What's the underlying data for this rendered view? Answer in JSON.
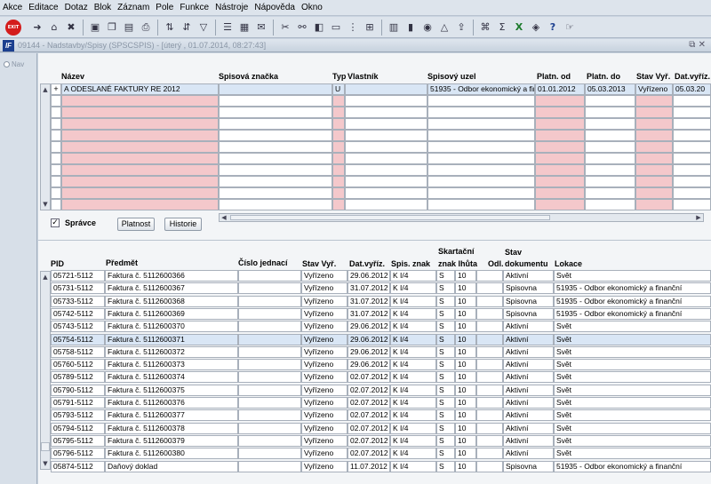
{
  "menu": [
    {
      "label": "Akce"
    },
    {
      "label": "Editace"
    },
    {
      "label": "Dotaz"
    },
    {
      "label": "Blok"
    },
    {
      "label": "Záznam"
    },
    {
      "label": "Pole"
    },
    {
      "label": "Funkce"
    },
    {
      "label": "Nástroje"
    },
    {
      "label": "Nápověda"
    },
    {
      "label": "Okno"
    }
  ],
  "toolbar": {
    "exit_label": "EXIT",
    "icons": [
      "save-icon",
      "home-icon",
      "delete-icon",
      "folder-icon",
      "copy-icon",
      "paste-icon",
      "print-icon",
      "sort-asc-icon",
      "sort-desc-icon",
      "filter-icon",
      "list-icon",
      "report-icon",
      "mail-icon",
      "cut-icon",
      "link-icon",
      "record-icon",
      "document-icon",
      "tree-icon",
      "grid-icon",
      "calculator-icon",
      "chart-icon",
      "globe-icon",
      "triangle-icon",
      "export-icon",
      "attach-icon",
      "sum-icon",
      "excel-icon",
      "lock-icon",
      "help-icon",
      "whatsnew-icon"
    ]
  },
  "window": {
    "logo": "IF",
    "title": "09144 - Nadstavby/Spisy (SPSCSPIS) - [úterý , 01.07.2014, 08:27:43]",
    "controls": "⧉ ✕"
  },
  "nav": {
    "label": "Nav"
  },
  "top_table": {
    "headers": [
      "Název",
      "Spisová značka",
      "Typ",
      "Vlastník",
      "Spisový uzel",
      "Platn. od",
      "Platn. do",
      "Stav Vyř.",
      "Dat.vyříz."
    ],
    "first_row": {
      "indicator": "+",
      "nazev": "A ODESLANÉ FAKTURY RE 2012",
      "spisova_znacka": "",
      "typ": "U",
      "vlastnik": "",
      "spisovy_uzel": "51935 - Odbor ekonomický a fin",
      "platn_od": "01.01.2012",
      "platn_do": "05.03.2013",
      "stav_vyr": "Vyřízeno",
      "dat_vyriz": "05.03.20"
    },
    "empty_rows": 10
  },
  "controls": {
    "spravce_label": "Správce",
    "spravce_checked": "✓",
    "platnost_label": "Platnost",
    "historie_label": "Historie"
  },
  "bottom_table": {
    "headers": {
      "pid": "PID",
      "predmet": "Předmět",
      "cislo_jednaci": "Číslo jednací",
      "stav_vyr": "Stav Vyř.",
      "dat_vyriz": "Dat.vyříz.",
      "spis_znak": "Spis. znak",
      "skartacni_1": "Skartační",
      "skartacni_2": "znak lhůta",
      "odl": "Odl.",
      "stav_dok_1": "Stav",
      "stav_dok_2": "dokumentu",
      "lokace": "Lokace"
    },
    "rows": [
      {
        "pid": "05721-5112",
        "predmet": "Faktura č. 5112600366",
        "cj": "",
        "stav": "Vyřízeno",
        "dat": "29.06.2012",
        "spis": "K I/4",
        "znak": "S",
        "lhuta": "10",
        "odl": "",
        "stavdok": "Aktivní",
        "lokace": "Svět"
      },
      {
        "pid": "05731-5112",
        "predmet": "Faktura č. 5112600367",
        "cj": "",
        "stav": "Vyřízeno",
        "dat": "31.07.2012",
        "spis": "K I/4",
        "znak": "S",
        "lhuta": "10",
        "odl": "",
        "stavdok": "Spisovna",
        "lokace": "51935 - Odbor ekonomický a finanční"
      },
      {
        "pid": "05733-5112",
        "predmet": "Faktura č. 5112600368",
        "cj": "",
        "stav": "Vyřízeno",
        "dat": "31.07.2012",
        "spis": "K I/4",
        "znak": "S",
        "lhuta": "10",
        "odl": "",
        "stavdok": "Spisovna",
        "lokace": "51935 - Odbor ekonomický a finanční"
      },
      {
        "pid": "05742-5112",
        "predmet": "Faktura č. 5112600369",
        "cj": "",
        "stav": "Vyřízeno",
        "dat": "31.07.2012",
        "spis": "K I/4",
        "znak": "S",
        "lhuta": "10",
        "odl": "",
        "stavdok": "Spisovna",
        "lokace": "51935 - Odbor ekonomický a finanční"
      },
      {
        "pid": "05743-5112",
        "predmet": "Faktura č. 5112600370",
        "cj": "",
        "stav": "Vyřízeno",
        "dat": "29.06.2012",
        "spis": "K I/4",
        "znak": "S",
        "lhuta": "10",
        "odl": "",
        "stavdok": "Aktivní",
        "lokace": "Svět"
      },
      {
        "pid": "05754-5112",
        "predmet": "Faktura č. 5112600371",
        "cj": "",
        "stav": "Vyřízeno",
        "dat": "29.06.2012",
        "spis": "K I/4",
        "znak": "S",
        "lhuta": "10",
        "odl": "",
        "stavdok": "Aktivní",
        "lokace": "Svět"
      },
      {
        "pid": "05758-5112",
        "predmet": "Faktura č. 5112600372",
        "cj": "",
        "stav": "Vyřízeno",
        "dat": "29.06.2012",
        "spis": "K I/4",
        "znak": "S",
        "lhuta": "10",
        "odl": "",
        "stavdok": "Aktivní",
        "lokace": "Svět"
      },
      {
        "pid": "05760-5112",
        "predmet": "Faktura č. 5112600373",
        "cj": "",
        "stav": "Vyřízeno",
        "dat": "29.06.2012",
        "spis": "K I/4",
        "znak": "S",
        "lhuta": "10",
        "odl": "",
        "stavdok": "Aktivní",
        "lokace": "Svět"
      },
      {
        "pid": "05789-5112",
        "predmet": "Faktura č. 5112600374",
        "cj": "",
        "stav": "Vyřízeno",
        "dat": "02.07.2012",
        "spis": "K I/4",
        "znak": "S",
        "lhuta": "10",
        "odl": "",
        "stavdok": "Aktivní",
        "lokace": "Svět"
      },
      {
        "pid": "05790-5112",
        "predmet": "Faktura č. 5112600375",
        "cj": "",
        "stav": "Vyřízeno",
        "dat": "02.07.2012",
        "spis": "K I/4",
        "znak": "S",
        "lhuta": "10",
        "odl": "",
        "stavdok": "Aktivní",
        "lokace": "Svět"
      },
      {
        "pid": "05791-5112",
        "predmet": "Faktura č. 5112600376",
        "cj": "",
        "stav": "Vyřízeno",
        "dat": "02.07.2012",
        "spis": "K I/4",
        "znak": "S",
        "lhuta": "10",
        "odl": "",
        "stavdok": "Aktivní",
        "lokace": "Svět"
      },
      {
        "pid": "05793-5112",
        "predmet": "Faktura č. 5112600377",
        "cj": "",
        "stav": "Vyřízeno",
        "dat": "02.07.2012",
        "spis": "K I/4",
        "znak": "S",
        "lhuta": "10",
        "odl": "",
        "stavdok": "Aktivní",
        "lokace": "Svět"
      },
      {
        "pid": "05794-5112",
        "predmet": "Faktura č. 5112600378",
        "cj": "",
        "stav": "Vyřízeno",
        "dat": "02.07.2012",
        "spis": "K I/4",
        "znak": "S",
        "lhuta": "10",
        "odl": "",
        "stavdok": "Aktivní",
        "lokace": "Svět"
      },
      {
        "pid": "05795-5112",
        "predmet": "Faktura č. 5112600379",
        "cj": "",
        "stav": "Vyřízeno",
        "dat": "02.07.2012",
        "spis": "K I/4",
        "znak": "S",
        "lhuta": "10",
        "odl": "",
        "stavdok": "Aktivní",
        "lokace": "Svět"
      },
      {
        "pid": "05796-5112",
        "predmet": "Faktura č. 5112600380",
        "cj": "",
        "stav": "Vyřízeno",
        "dat": "02.07.2012",
        "spis": "K I/4",
        "znak": "S",
        "lhuta": "10",
        "odl": "",
        "stavdok": "Aktivní",
        "lokace": "Svět"
      },
      {
        "pid": "05874-5112",
        "predmet": "Daňový doklad",
        "cj": "",
        "stav": "Vyřízeno",
        "dat": "11.07.2012",
        "spis": "K I/4",
        "znak": "S",
        "lhuta": "10",
        "odl": "",
        "stavdok": "Spisovna",
        "lokace": "51935 - Odbor ekonomický a finanční"
      }
    ],
    "selected_row": 5
  },
  "colors": {
    "required": "#f4c8cb",
    "selected": "#d9e6f5",
    "exit": "#d41c1c"
  }
}
